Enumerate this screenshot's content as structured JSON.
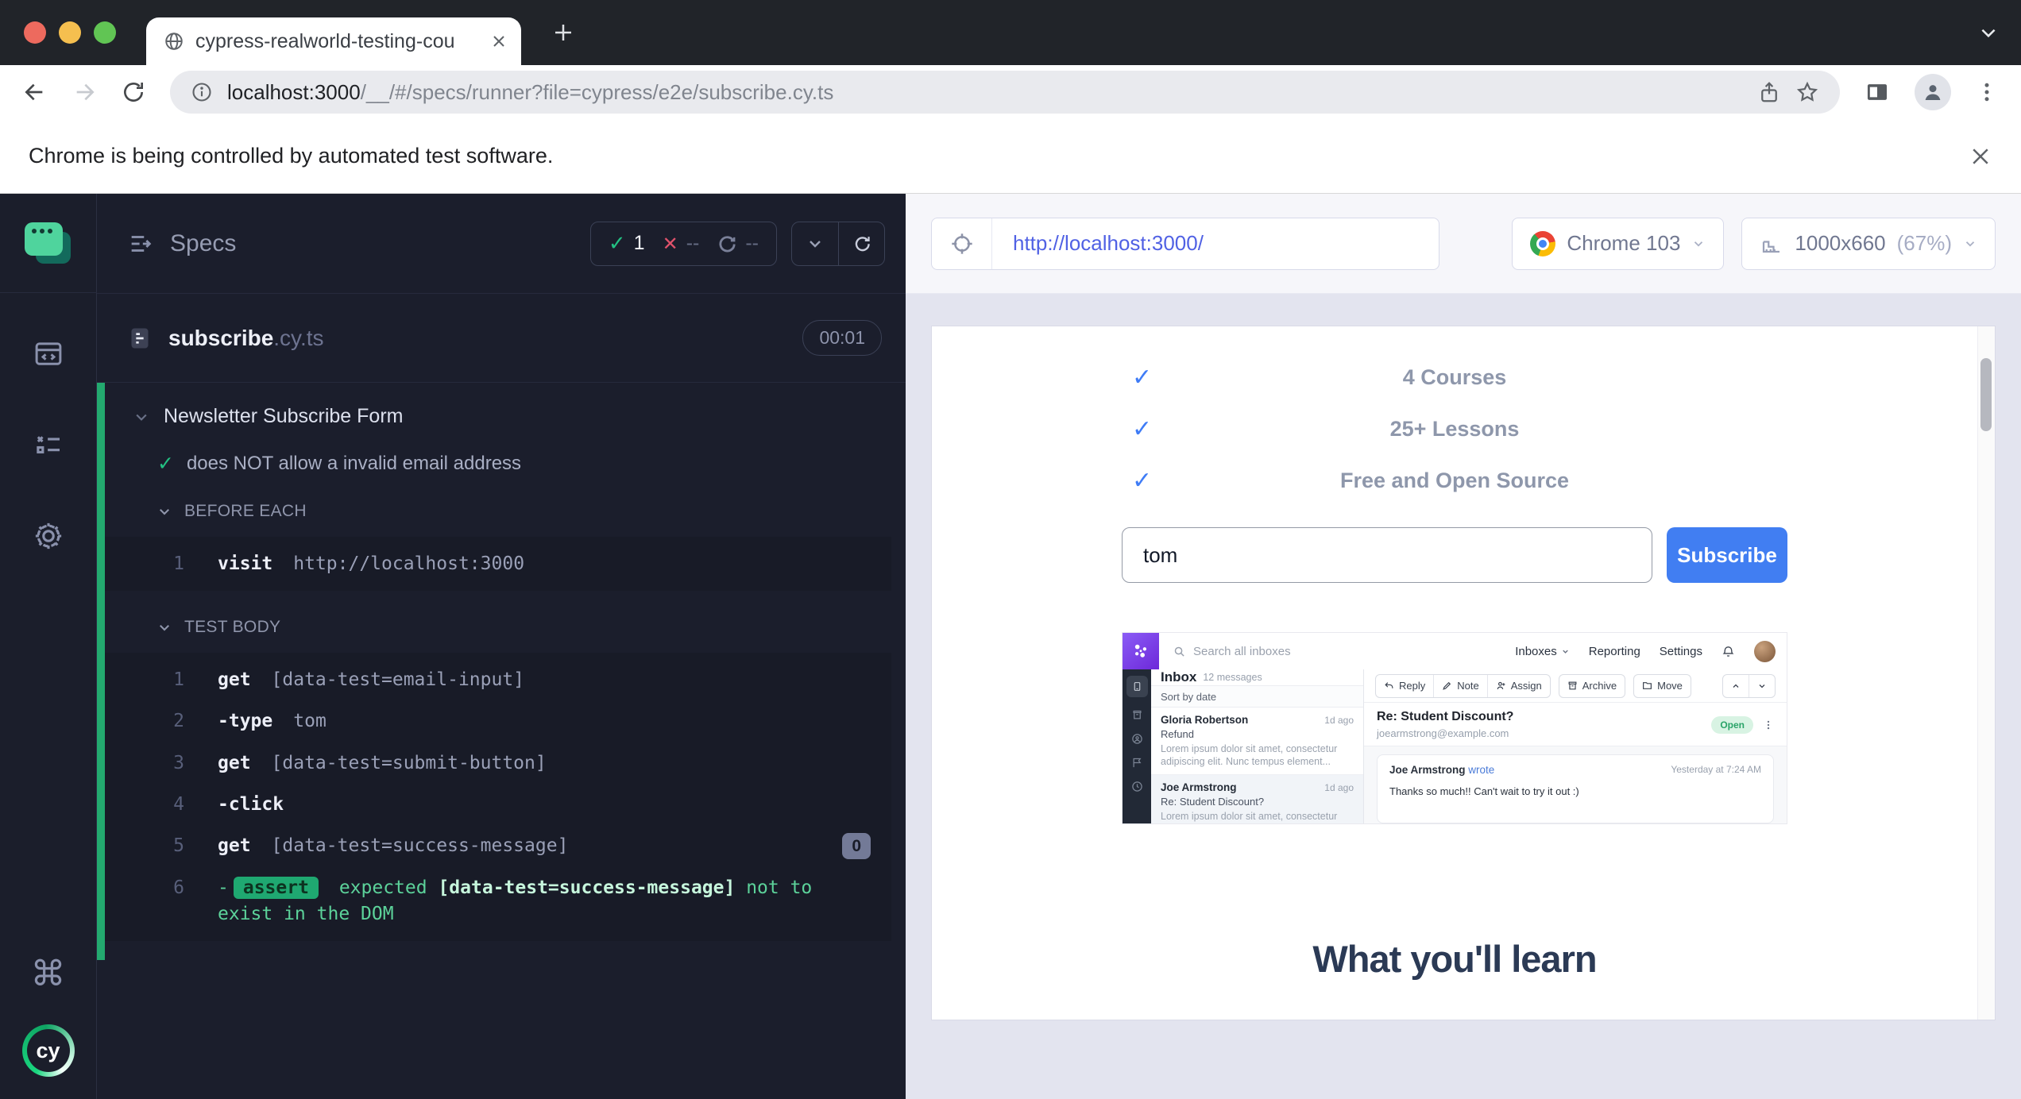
{
  "chrome": {
    "tab": {
      "title": "cypress-realworld-testing-cou"
    },
    "toolbar": {
      "url_host": "localhost:3000",
      "url_path": "/__/#/specs/runner?file=cypress/e2e/subscribe.cy.ts"
    },
    "infobar": {
      "message": "Chrome is being controlled by automated test software."
    }
  },
  "cypress": {
    "rail": {
      "command_glyph": "⌘",
      "logo_text": "cy"
    },
    "specs": {
      "title": "Specs",
      "stats": {
        "passed": "1",
        "failed": "--",
        "pending": "--"
      },
      "file": {
        "name": "subscribe",
        "ext": ".cy.ts",
        "duration": "00:01"
      },
      "suite": {
        "title": "Newsletter Subscribe Form"
      },
      "test": {
        "title": "does NOT allow a invalid email address"
      },
      "before_each": {
        "label": "BEFORE EACH",
        "commands": [
          {
            "num": "1",
            "name": "visit",
            "message": "http://localhost:3000"
          }
        ]
      },
      "test_body": {
        "label": "TEST BODY",
        "commands": [
          {
            "num": "1",
            "name": "get",
            "message": "[data-test=email-input]"
          },
          {
            "num": "2",
            "name": "-type",
            "message": "tom"
          },
          {
            "num": "3",
            "name": "get",
            "message": "[data-test=submit-button]"
          },
          {
            "num": "4",
            "name": "-click",
            "message": ""
          },
          {
            "num": "5",
            "name": "get",
            "message": "[data-test=success-message]",
            "badge": "0"
          },
          {
            "num": "6",
            "name": "-",
            "pill": "assert",
            "expected": "expected",
            "target": "[data-test=success-message]",
            "suffix": "not to exist in the DOM"
          }
        ]
      }
    },
    "preview": {
      "url": "http://localhost:3000/",
      "browser": "Chrome 103",
      "viewport": "1000x660",
      "scale": "(67%)"
    }
  },
  "aut": {
    "features": [
      {
        "label": "4 Courses"
      },
      {
        "label": "25+ Lessons"
      },
      {
        "label": "Free and Open Source"
      }
    ],
    "form": {
      "email_value": "tom",
      "submit_label": "Subscribe"
    },
    "heading": "What you'll learn",
    "email_app": {
      "search": "Search all inboxes",
      "nav": [
        {
          "label": "Inboxes"
        },
        {
          "label": "Reporting"
        },
        {
          "label": "Settings"
        }
      ],
      "inbox": {
        "title": "Inbox",
        "count": "12 messages"
      },
      "actions": [
        {
          "label": "Reply"
        },
        {
          "label": "Note"
        },
        {
          "label": "Assign"
        },
        {
          "label": "Archive"
        },
        {
          "label": "Move"
        }
      ],
      "sort": "Sort by date",
      "messages": [
        {
          "sender": "Gloria Robertson",
          "time": "1d ago",
          "subject": "Refund",
          "preview": "Lorem ipsum dolor sit amet, consectetur adipiscing elit. Nunc tempus element..."
        },
        {
          "sender": "Joe Armstrong",
          "time": "1d ago",
          "subject": "Re: Student Discount?",
          "preview": "Lorem ipsum dolor sit amet, consectetur"
        }
      ],
      "detail": {
        "subject": "Re: Student Discount?",
        "from": "joearmstrong@example.com",
        "status": "Open",
        "author": "Joe Armstrong",
        "wrote_label": "wrote",
        "time": "Yesterday at 7:24 AM",
        "body": "Thanks so much!! Can't wait to try it out :)"
      }
    }
  },
  "colors": {
    "pass_green": "#23c183",
    "fail_red": "#e0526b",
    "assert_green": "#1fa871",
    "aut_link_blue": "#5061e4",
    "subscribe_blue": "#417ef2",
    "check_blue": "#3f7cf6",
    "traffic_red": "#ed6a5e",
    "traffic_yellow": "#f5bf4f",
    "traffic_green": "#61c554"
  }
}
